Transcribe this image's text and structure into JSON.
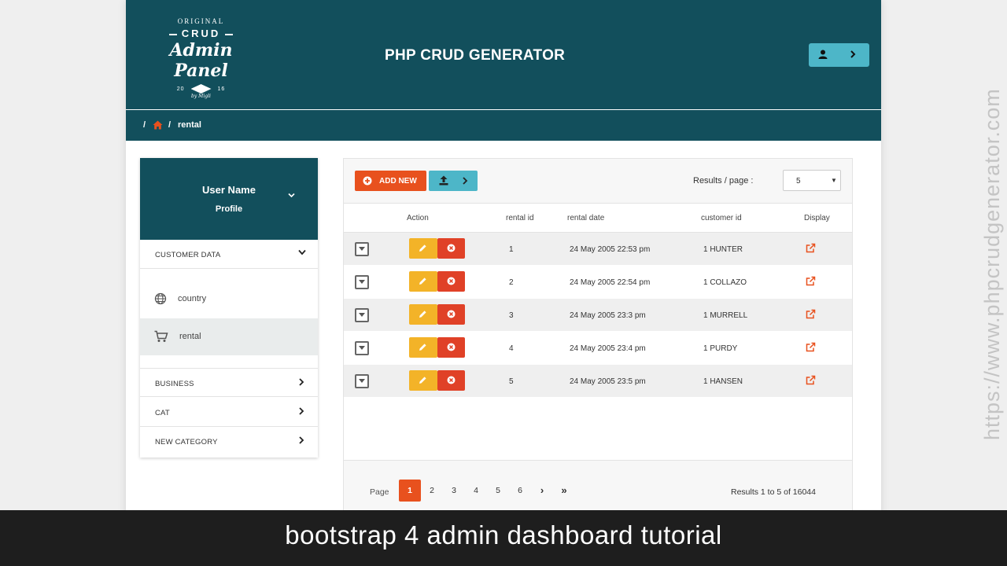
{
  "logo": {
    "line1": "ORIGINAL",
    "line2": "CRUD",
    "line3": "Admin Panel",
    "year_left": "20",
    "year_right": "16",
    "byline": "by Migli"
  },
  "header": {
    "title": "PHP CRUD GENERATOR",
    "user_icon": "user-icon",
    "menu_icon": "chevron-right-icon"
  },
  "breadcrumb": {
    "sep1": "/",
    "home_icon": "home-icon",
    "sep2": "/",
    "current": "rental"
  },
  "sidebar": {
    "profile": {
      "name": "User Name",
      "link": "Profile"
    },
    "categories": [
      {
        "label": "CUSTOMER DATA",
        "expanded": true,
        "items": [
          {
            "label": "country",
            "icon": "globe-icon",
            "active": false
          },
          {
            "label": "rental",
            "icon": "cart-icon",
            "active": true
          }
        ]
      },
      {
        "label": "BUSINESS",
        "expanded": false
      },
      {
        "label": "CAT",
        "expanded": false
      },
      {
        "label": "NEW CATEGORY",
        "expanded": false
      }
    ]
  },
  "toolbar": {
    "add_new_label": "ADD NEW",
    "results_per_page_label": "Results / page :",
    "results_per_page_value": "5"
  },
  "table": {
    "columns": [
      "Action",
      "rental id",
      "rental date",
      "customer id",
      "Display"
    ],
    "rows": [
      {
        "rental_id": "1",
        "rental_date": "24 May 2005 22:53 pm",
        "customer_id": "1 HUNTER"
      },
      {
        "rental_id": "2",
        "rental_date": "24 May 2005 22:54 pm",
        "customer_id": "1 COLLAZO"
      },
      {
        "rental_id": "3",
        "rental_date": "24 May 2005 23:3 pm",
        "customer_id": "1 MURRELL"
      },
      {
        "rental_id": "4",
        "rental_date": "24 May 2005 23:4 pm",
        "customer_id": "1 PURDY"
      },
      {
        "rental_id": "5",
        "rental_date": "24 May 2005 23:5 pm",
        "customer_id": "1 HANSEN"
      }
    ]
  },
  "pagination": {
    "label": "Page",
    "pages": [
      "1",
      "2",
      "3",
      "4",
      "5",
      "6"
    ],
    "current": "1",
    "next": "›",
    "last": "»",
    "info": "Results 1 to 5 of 16044"
  },
  "watermark": "https://www.phpcrudgenerator.com",
  "caption": "bootstrap 4 admin dashboard tutorial",
  "colors": {
    "header_bg": "#124f5c",
    "accent_orange": "#e8511e",
    "accent_cyan": "#4db6c8",
    "edit_yellow": "#f3b328",
    "delete_red": "#e04127"
  }
}
